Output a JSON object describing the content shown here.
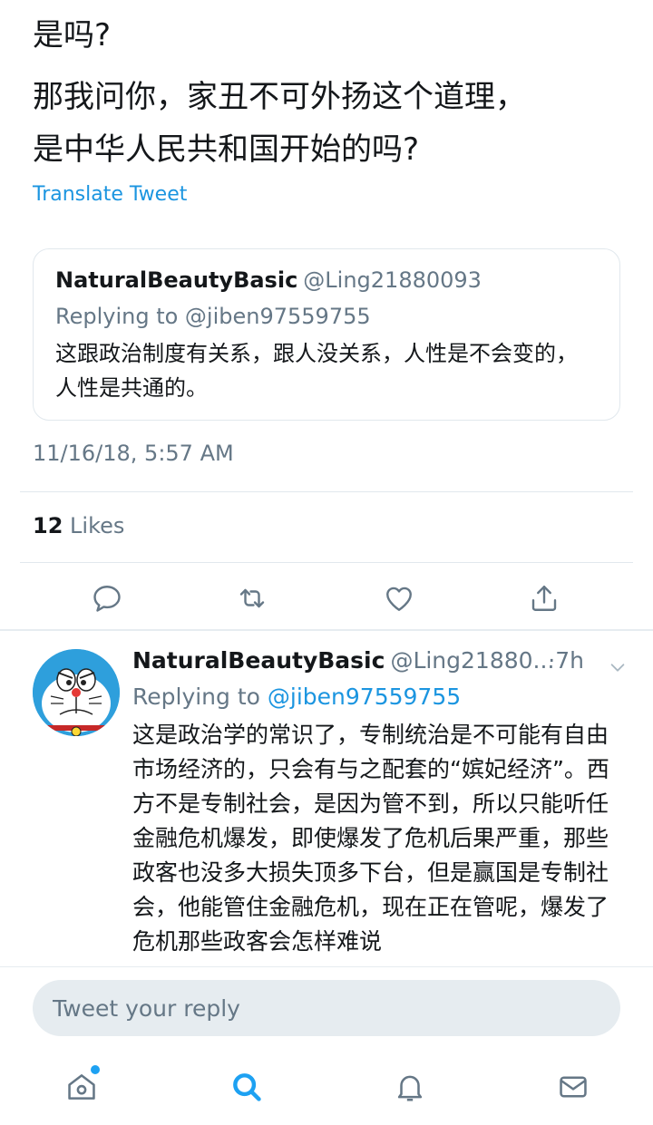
{
  "tweet": {
    "lines": [
      "是吗?",
      "那我问你，家丑不可外扬这个道理，",
      "是中华人民共和国开始的吗?"
    ],
    "translate_label": "Translate Tweet",
    "timestamp": "11/16/18, 5:57 AM",
    "likes_count": "12",
    "likes_label": "Likes"
  },
  "quoted": {
    "name": "NaturalBeautyBasic",
    "handle": "@Ling21880093",
    "replying_to": "Replying to @jiben97559755",
    "text": "这跟政治制度有关系，跟人没关系，人性是不会变的，人性是共通的。"
  },
  "actions": [
    "reply-icon",
    "retweet-icon",
    "like-icon",
    "share-icon"
  ],
  "reply_tweet": {
    "name": "NaturalBeautyBasic",
    "handle": "@Ling21880...",
    "time": "·7h",
    "replying_prefix": "Replying to",
    "replying_handle": "@jiben97559755",
    "text": "这是政治学的常识了，专制统治是不可能有自由市场经济的，只会有与之配套的“嫔妃经济”。西方不是专制社会，是因为管不到，所以只能听任金融危机爆发，即使爆发了危机后果严重，那些政客也没多大损失顶多下台，但是赢国是专制社会，他能管住金融危机，现在正在管呢，爆发了危机那些政客会怎样难说"
  },
  "reply_box": {
    "placeholder": "Tweet your reply"
  },
  "tabbar": [
    "home-icon",
    "search-icon",
    "notifications-icon",
    "messages-icon"
  ],
  "colors": {
    "accent": "#1da1f2",
    "link": "#1b95e0",
    "secondary_text": "#657786",
    "divider": "#e1e8ed"
  }
}
